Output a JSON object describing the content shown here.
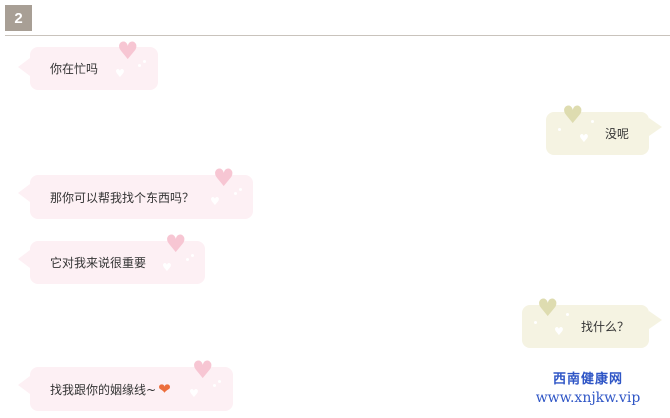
{
  "step": "2",
  "messages": [
    {
      "side": "left",
      "text": "你在忙吗"
    },
    {
      "side": "right",
      "text": "没呢"
    },
    {
      "side": "left",
      "text": "那你可以帮我找个东西吗？"
    },
    {
      "side": "left",
      "text": "它对我来说很重要"
    },
    {
      "side": "right",
      "text": "找什么？"
    },
    {
      "side": "left",
      "text": "找我跟你的姻缘线~"
    }
  ],
  "emoji": {
    "icon": "orange-heart-icon",
    "glyph": "❤"
  },
  "watermark": {
    "title": "西南健康网",
    "url": "www.xnjkw.vip"
  },
  "colors": {
    "left_bubble": "#fdf0f4",
    "right_bubble": "#f5f3e2",
    "pink_heart": "#f7c6d3",
    "beige_heart": "#dedcb0",
    "badge": "#a89f95",
    "watermark": "#2f56c6"
  }
}
